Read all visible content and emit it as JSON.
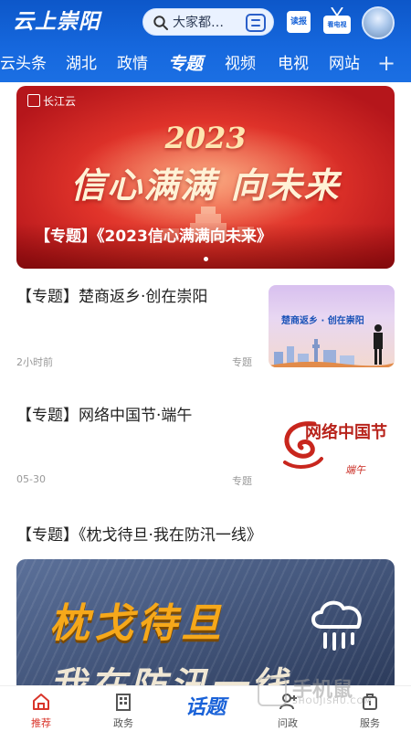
{
  "header": {
    "logo_text": "云上崇阳",
    "search_placeholder": "大家都…",
    "paper_label": "读报",
    "tv_label": "看电视",
    "colors": {
      "primary": "#1668de",
      "accent_red": "#d9352b"
    }
  },
  "tabs": [
    {
      "label": "云头条"
    },
    {
      "label": "湖北"
    },
    {
      "label": "政情"
    },
    {
      "label": "专题",
      "active": true
    },
    {
      "label": "视频"
    },
    {
      "label": "电视"
    },
    {
      "label": "网站"
    }
  ],
  "tab_more": "+",
  "banner": {
    "brand": "长江云",
    "year": "2023",
    "slogan": "信心满满 向未来",
    "caption": "【专题】《2023信心满满向未来》"
  },
  "news": [
    {
      "title": "【专题】楚商返乡·创在崇阳",
      "time": "2小时前",
      "tag": "专题",
      "thumb_text": "楚商返乡 · 创在崇阳"
    },
    {
      "title": "【专题】网络中国节·端午",
      "time": "05-30",
      "tag": "专题",
      "thumb_text": "网络中国节",
      "thumb_sub": "端午"
    }
  ],
  "feature": {
    "title": "【专题】《枕戈待旦·我在防汛一线》",
    "image_title": "枕戈待旦",
    "image_sub": "我在防汛一线"
  },
  "bottom_nav": [
    {
      "label": "推荐",
      "icon": "home-icon",
      "active": true
    },
    {
      "label": "政务",
      "icon": "building-icon"
    },
    {
      "label": "话题",
      "icon": "topic-text"
    },
    {
      "label": "问政",
      "icon": "ask-user-icon"
    },
    {
      "label": "服务",
      "icon": "service-icon"
    }
  ],
  "watermark": {
    "text": "手机鼠",
    "sub": "SHOUJISHU.COM"
  }
}
